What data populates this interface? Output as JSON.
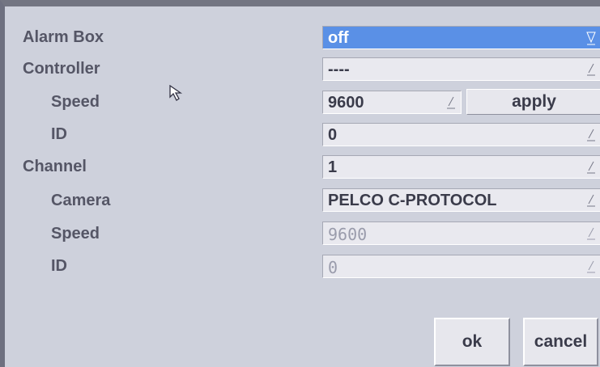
{
  "rows": [
    {
      "label": "Alarm Box",
      "value": "off"
    },
    {
      "label": "Controller",
      "value": "----"
    },
    {
      "label": "Speed",
      "value": "9600"
    },
    {
      "label": "ID",
      "value": "0"
    },
    {
      "label": "Channel",
      "value": "1"
    },
    {
      "label": "Camera",
      "value": "PELCO C-PROTOCOL"
    },
    {
      "label": "Speed",
      "value": "9600"
    },
    {
      "label": "ID",
      "value": "0"
    }
  ],
  "buttons": {
    "apply": "apply",
    "ok": "ok",
    "cancel": "cancel"
  },
  "icons": {
    "dropdown": "dropdown-icon",
    "cursor": "mouse-pointer-icon"
  },
  "colors": {
    "selected": "#5a90e6",
    "panel": "#ced1dc",
    "label": "#555666"
  }
}
